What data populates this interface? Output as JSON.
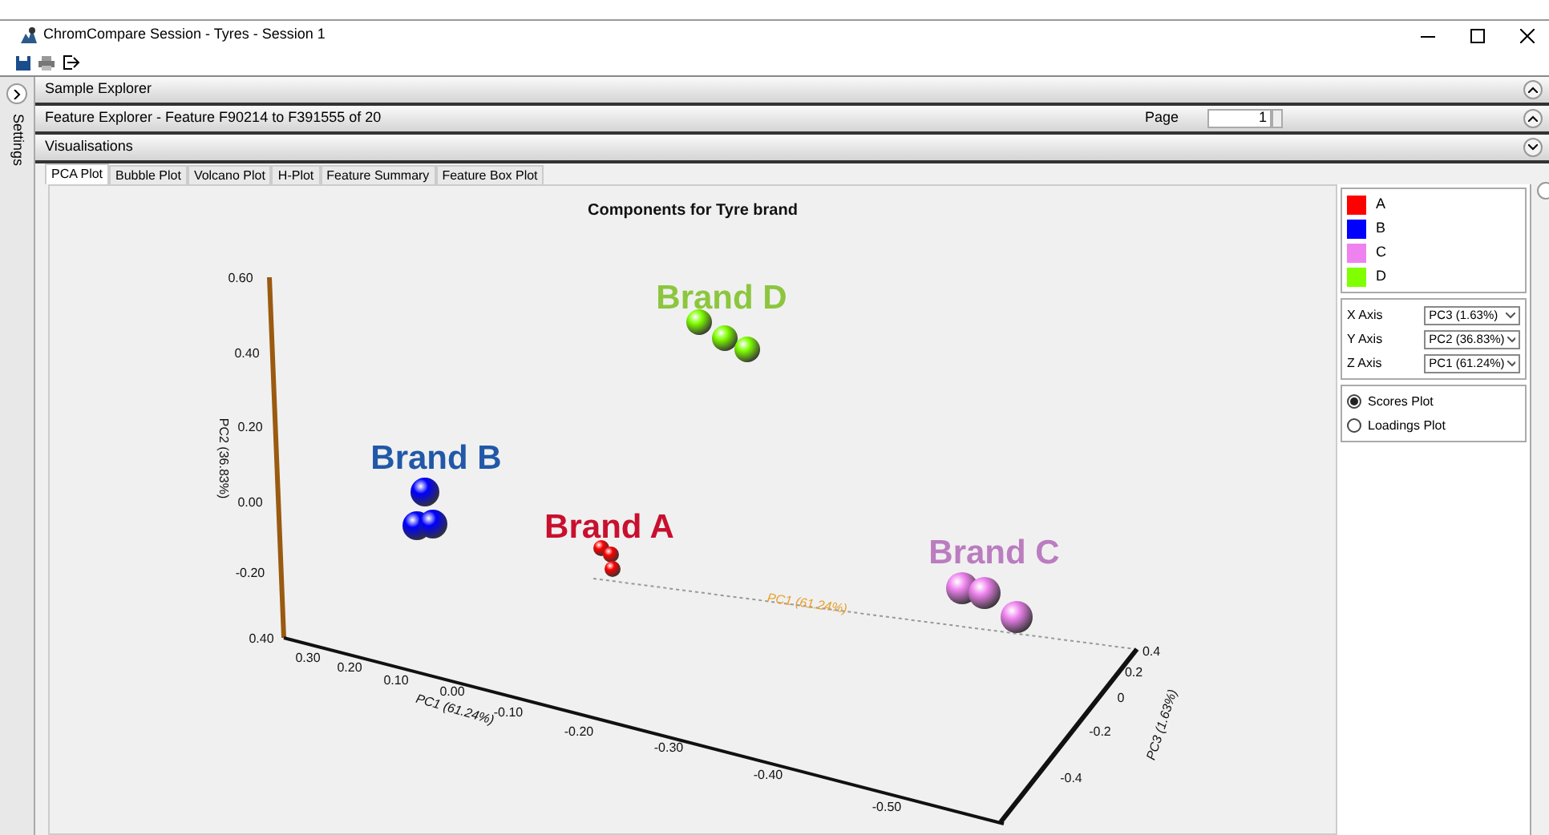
{
  "window": {
    "title": "ChromCompare Session - Tyres - Session 1"
  },
  "sidebar": {
    "label": "Settings"
  },
  "panels": [
    {
      "title": "Sample Explorer",
      "expanded": false
    },
    {
      "title": "Feature Explorer - Feature F90214 to F391555 of 20",
      "expanded": false,
      "page_label": "Page",
      "page_value": "1"
    },
    {
      "title": "Visualisations",
      "expanded": true
    }
  ],
  "tabs": [
    {
      "label": "PCA Plot",
      "selected": true
    },
    {
      "label": "Bubble Plot",
      "selected": false
    },
    {
      "label": "Volcano Plot",
      "selected": false
    },
    {
      "label": "H-Plot",
      "selected": false
    },
    {
      "label": "Feature Summary",
      "selected": false
    },
    {
      "label": "Feature Box Plot",
      "selected": false
    }
  ],
  "plot": {
    "title": "Components for Tyre brand",
    "axes": [
      {
        "label": "PC2 (36.83%)",
        "ticks": [
          "0.60",
          "0.40",
          "0.20",
          "0.00",
          "-0.20",
          "0.40"
        ]
      },
      {
        "label": "PC1 (61.24%)",
        "ticks": [
          "0.30",
          "0.20",
          "0.10",
          "0.00",
          "-0.10",
          "-0.20",
          "-0.30",
          "-0.40",
          "-0.50"
        ]
      },
      {
        "label": "PC3 (1.63%)",
        "ticks": [
          "0.4",
          "0.2",
          "0",
          "-0.2",
          "-0.4"
        ]
      }
    ],
    "floor_label": "PC1 (61.24%)",
    "annotations": [
      {
        "text": "Brand D",
        "color": "#8cc63e"
      },
      {
        "text": "Brand B",
        "color": "#2158a8"
      },
      {
        "text": "Brand A",
        "color": "#c8102e"
      },
      {
        "text": "Brand C",
        "color": "#bb7cc0"
      }
    ]
  },
  "legend": [
    {
      "label": "A",
      "color": "#ff0000"
    },
    {
      "label": "B",
      "color": "#0000ff"
    },
    {
      "label": "C",
      "color": "#ee82ee"
    },
    {
      "label": "D",
      "color": "#7fff00"
    }
  ],
  "axis_selectors": [
    {
      "label": "X Axis",
      "value": "PC3 (1.63%)"
    },
    {
      "label": "Y Axis",
      "value": "PC2 (36.83%)"
    },
    {
      "label": "Z Axis",
      "value": "PC1 (61.24%)"
    }
  ],
  "plot_types": [
    {
      "label": "Scores Plot",
      "selected": true
    },
    {
      "label": "Loadings Plot",
      "selected": false
    }
  ]
}
